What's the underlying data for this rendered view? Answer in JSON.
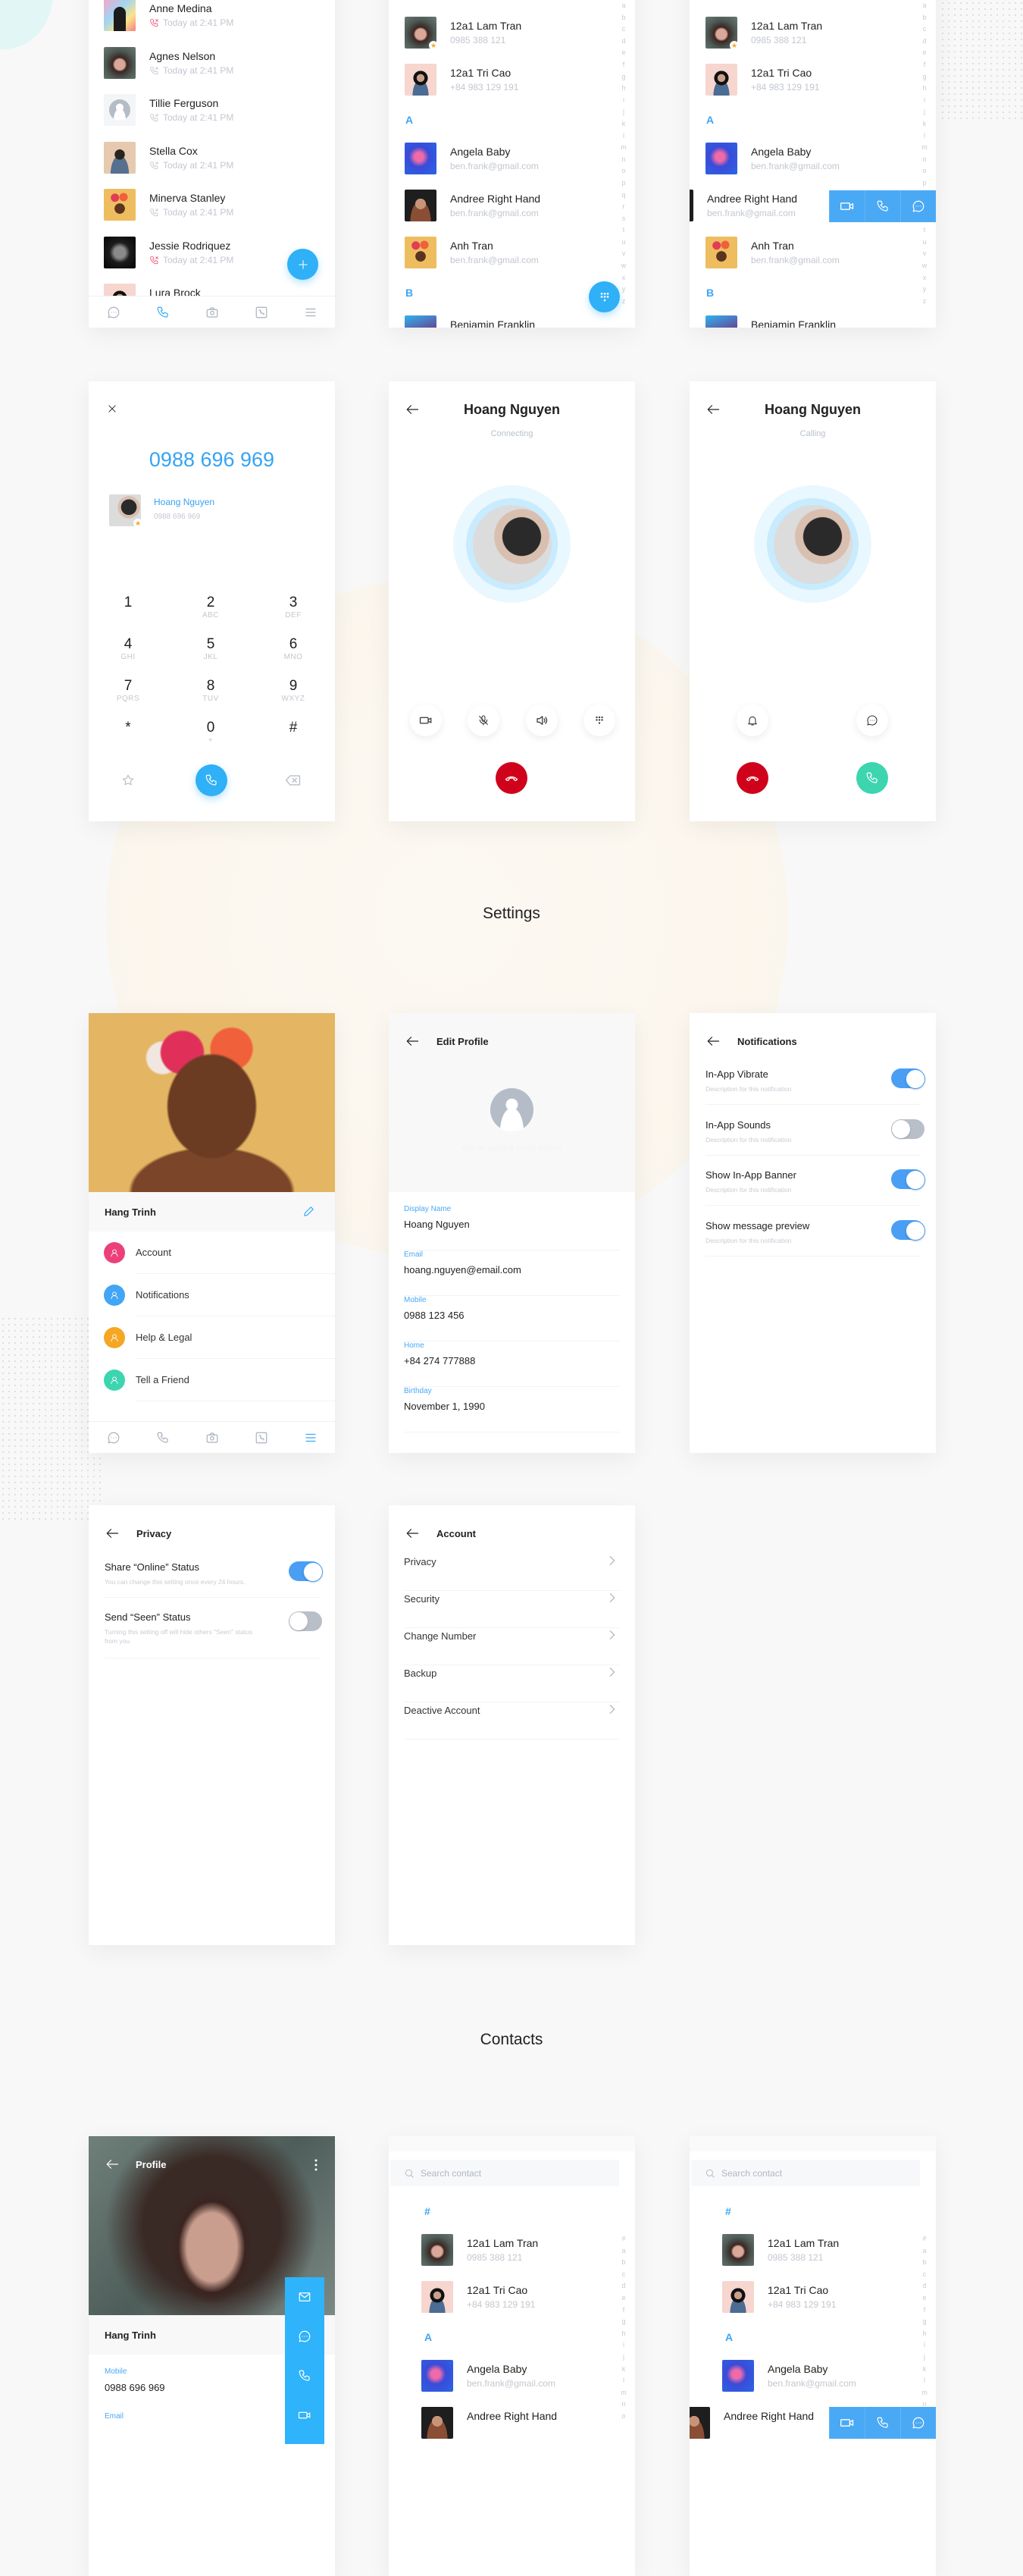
{
  "sections": {
    "settings": "Settings",
    "contacts": "Contacts"
  },
  "call_log": {
    "items": [
      {
        "name": "Anne Medina",
        "time": "Today at 2:41 PM",
        "type": "missed",
        "avatar": "pattern"
      },
      {
        "name": "Agnes Nelson",
        "time": "Today at 2:41 PM",
        "type": "incoming",
        "avatar": "fur"
      },
      {
        "name": "Tillie Ferguson",
        "time": "Today at 2:41 PM",
        "type": "incoming",
        "avatar": "placeholder"
      },
      {
        "name": "Stella Cox",
        "time": "Today at 2:41 PM",
        "type": "outgoing",
        "avatar": "curly"
      },
      {
        "name": "Minerva Stanley",
        "time": "Today at 2:41 PM",
        "type": "incoming",
        "avatar": "flowers"
      },
      {
        "name": "Jessie Rodriquez",
        "time": "Today at 2:41 PM",
        "type": "missed",
        "avatar": "bw"
      },
      {
        "name": "Lura Brock",
        "avatar": "pink"
      }
    ],
    "fab_icon": "plus-icon"
  },
  "nav": {
    "items": [
      "chat-icon",
      "phone-icon",
      "camera-icon",
      "contacts-icon",
      "menu-icon"
    ]
  },
  "alphabet": [
    "a",
    "b",
    "c",
    "d",
    "e",
    "f",
    "g",
    "h",
    "i",
    "j",
    "k",
    "l",
    "m",
    "n",
    "o",
    "p",
    "q",
    "r",
    "s",
    "t",
    "u",
    "v",
    "w",
    "x",
    "y",
    "z"
  ],
  "alphabet_search": [
    "#",
    "a",
    "b",
    "c",
    "d",
    "e",
    "f",
    "g",
    "h",
    "i",
    "j",
    "k",
    "l",
    "m",
    "n",
    "o"
  ],
  "contacts": {
    "rows": [
      {
        "kind": "contact",
        "name": "12a1 Lam Tran",
        "detail": "0985 388 121",
        "avatar": "fur",
        "fav": true
      },
      {
        "kind": "contact",
        "name": "12a1 Tri Cao",
        "detail": "+84 983 129 191",
        "avatar": "pink",
        "fav": false
      },
      {
        "kind": "header",
        "letter": "A"
      },
      {
        "kind": "contact",
        "name": "Angela Baby",
        "detail": "ben.frank@gmail.com",
        "avatar": "neon",
        "fav": false
      },
      {
        "kind": "contact",
        "name": "Andree Right Hand",
        "detail": "ben.frank@gmail.com",
        "avatar": "sunglasses",
        "fav": false
      },
      {
        "kind": "contact",
        "name": "Anh Tran",
        "detail": "ben.frank@gmail.com",
        "avatar": "flowers",
        "fav": false
      },
      {
        "kind": "header",
        "letter": "B"
      },
      {
        "kind": "contact",
        "name": "Benjamin Franklin",
        "detail": "",
        "avatar": "purple",
        "fav": false
      }
    ],
    "fab_icon": "dialpad-icon",
    "swipe_actions": [
      "video-icon",
      "phone-icon",
      "chat-icon"
    ]
  },
  "contacts_search": {
    "placeholder": "Search contact",
    "rows": [
      {
        "kind": "header",
        "letter": "#"
      },
      {
        "kind": "contact",
        "name": "12a1 Lam Tran",
        "detail": "0985 388 121",
        "avatar": "fur"
      },
      {
        "kind": "contact",
        "name": "12a1 Tri Cao",
        "detail": "+84 983 129 191",
        "avatar": "pink"
      },
      {
        "kind": "header",
        "letter": "A"
      },
      {
        "kind": "contact",
        "name": "Angela Baby",
        "detail": "ben.frank@gmail.com",
        "avatar": "neon"
      },
      {
        "kind": "contact",
        "name": "Andree Right Hand",
        "detail": "",
        "avatar": "sunglasses"
      }
    ]
  },
  "dialer": {
    "number": "0988 696 969",
    "match_name": "Hoang Nguyen",
    "match_number": "0988 696 969",
    "keys": [
      {
        "d": "1",
        "l": ""
      },
      {
        "d": "2",
        "l": "ABC"
      },
      {
        "d": "3",
        "l": "DEF"
      },
      {
        "d": "4",
        "l": "GHI"
      },
      {
        "d": "5",
        "l": "JKL"
      },
      {
        "d": "6",
        "l": "MNO"
      },
      {
        "d": "7",
        "l": "PQRS"
      },
      {
        "d": "8",
        "l": "TUV"
      },
      {
        "d": "9",
        "l": "WXYZ"
      },
      {
        "d": "*",
        "l": ""
      },
      {
        "d": "0",
        "l": "+"
      },
      {
        "d": "#",
        "l": ""
      }
    ]
  },
  "connecting": {
    "name": "Hoang Nguyen",
    "status": "Connecting"
  },
  "calling": {
    "name": "Hoang Nguyen",
    "status": "Calling"
  },
  "colors": {
    "accent": "#36a9f7",
    "end_call": "#d0021b",
    "accept_call": "#3dd5b0",
    "missed": "#f0527a"
  },
  "settings_home": {
    "name": "Hang Trinh",
    "menu": [
      {
        "label": "Account",
        "icon": "user-icon",
        "color": "#ec407a"
      },
      {
        "label": "Notifications",
        "icon": "bell-icon",
        "color": "#42a5f5"
      },
      {
        "label": "Help & Legal",
        "icon": "info-icon",
        "color": "#f5a623"
      },
      {
        "label": "Tell a Friend",
        "icon": "share-icon",
        "color": "#3dd5b0"
      }
    ]
  },
  "edit_profile": {
    "title": "Edit Profile",
    "photo_hint": "Add an optional profile picture",
    "fields": [
      {
        "label": "Display Name",
        "value": "Hoang Nguyen"
      },
      {
        "label": "Email",
        "value": "hoang.nguyen@email.com"
      },
      {
        "label": "Mobile",
        "value": "0988 123 456"
      },
      {
        "label": "Home",
        "value": "+84 274 777888"
      },
      {
        "label": "Birthday",
        "value": "November 1, 1990"
      }
    ]
  },
  "notifications": {
    "title": "Notifications",
    "items": [
      {
        "label": "In-App Vibrate",
        "desc": "Description for this notification",
        "on": true
      },
      {
        "label": "In-App Sounds",
        "desc": "Description for this notification",
        "on": false
      },
      {
        "label": "Show In-App Banner",
        "desc": "Description for this notification",
        "on": true
      },
      {
        "label": "Show message preview",
        "desc": "Description for this notification",
        "on": true
      }
    ]
  },
  "privacy": {
    "title": "Privacy",
    "items": [
      {
        "label": "Share “Online” Status",
        "desc": "You can change this setting once every 24 hours.",
        "on": true
      },
      {
        "label": "Send “Seen” Status",
        "desc": "Turning this setting off will hide others \"Seen\" status from you",
        "on": false
      }
    ]
  },
  "account": {
    "title": "Account",
    "items": [
      "Privacy",
      "Security",
      "Change Number",
      "Backup",
      "Deactive Account"
    ]
  },
  "profile": {
    "title": "Profile",
    "name": "Hang Trinh",
    "mobile_label": "Mobile",
    "mobile": "0988 696 969",
    "email_label": "Email",
    "actions": [
      "mail-icon",
      "chat-icon",
      "phone-icon",
      "video-icon"
    ]
  }
}
